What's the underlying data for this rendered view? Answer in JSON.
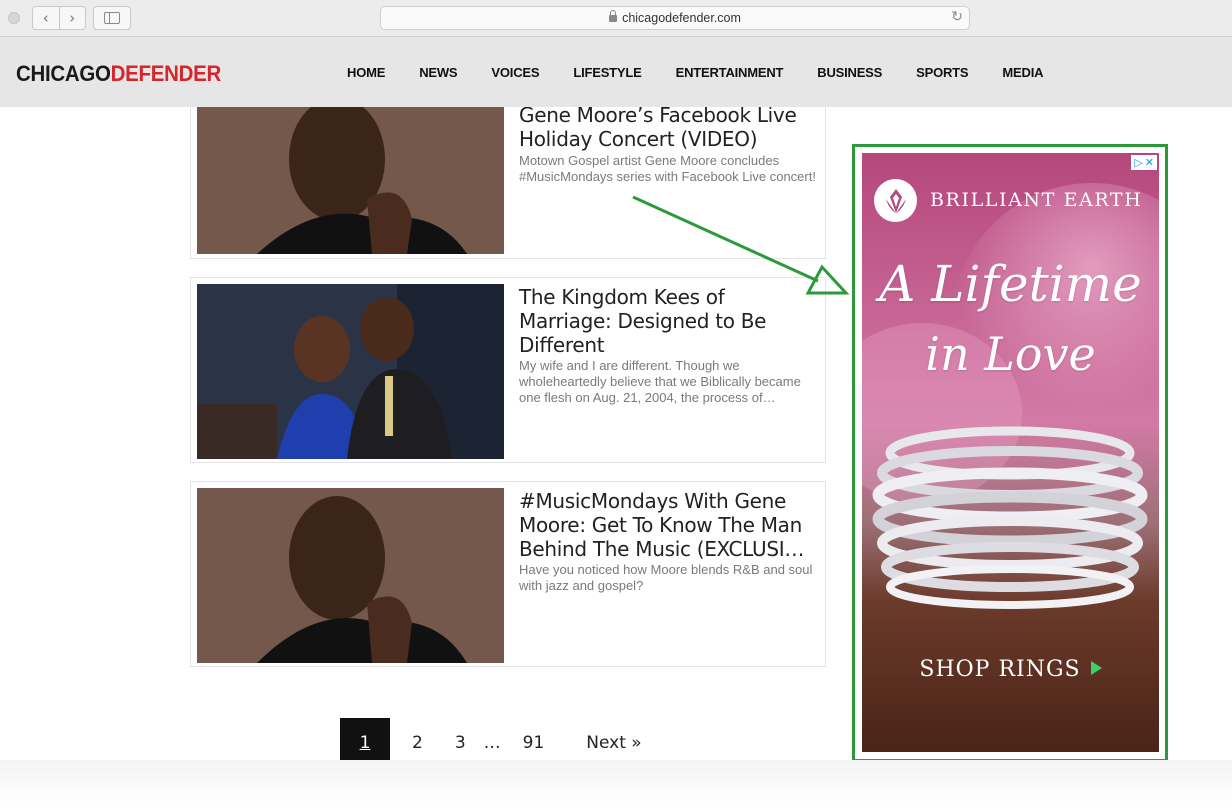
{
  "browser": {
    "url": "chicagodefender.com",
    "back_icon": "chevron-left-icon",
    "forward_icon": "chevron-right-icon",
    "reload_icon": "reload-icon"
  },
  "site": {
    "logo_part1": "CHICAGO",
    "logo_part2": "DEFENDER",
    "brand_red": "#d6262b",
    "nav": [
      "HOME",
      "NEWS",
      "VOICES",
      "LIFESTYLE",
      "ENTERTAINMENT",
      "BUSINESS",
      "SPORTS",
      "MEDIA"
    ]
  },
  "articles": [
    {
      "title": "Gene Moore’s Facebook Live Holiday Concert (VIDEO)",
      "excerpt": "Motown Gospel artist Gene Moore concludes #MusicMondays series with Facebook Live concert!"
    },
    {
      "title": "The Kingdom Kees of Marriage: Designed to Be Different",
      "excerpt": "My wife and I are different.  Though we wholeheartedly believe that we Biblically became one flesh on Aug. 21, 2004, the process of…"
    },
    {
      "title": "#MusicMondays With Gene Moore: Get To Know The Man Behind The Music (EXCLUSI…",
      "excerpt": "Have you noticed how Moore blends R&B and soul with jazz and gospel?"
    }
  ],
  "pagination": {
    "current": "1",
    "pages": [
      "2",
      "3"
    ],
    "ellipsis": "…",
    "last": "91",
    "next": "Next »"
  },
  "ad": {
    "brand": "BRILLIANT EARTH",
    "headline_line1": "A Lifetime",
    "headline_line2": "in Love",
    "cta": "SHOP RINGS",
    "adchoices_icon": "adchoices-icon",
    "close_icon": "close-icon",
    "highlight_color": "#2d9a3a"
  }
}
